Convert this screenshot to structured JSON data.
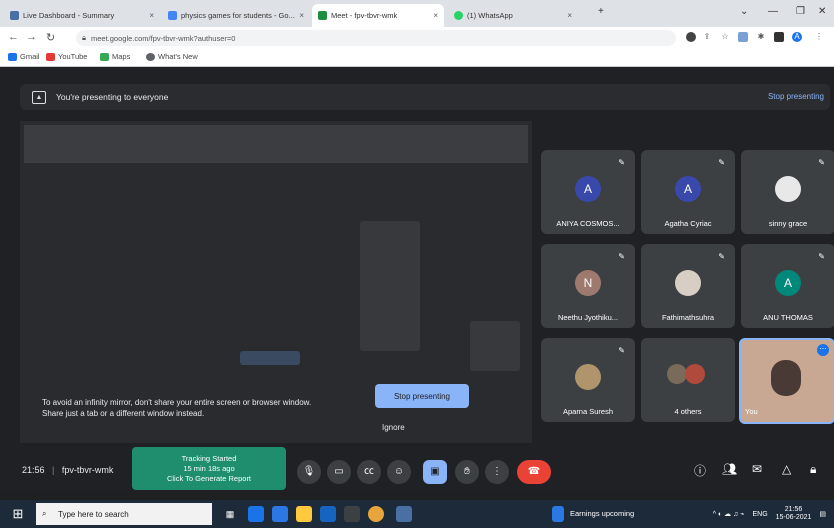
{
  "browser": {
    "tabs": [
      {
        "label": "Live Dashboard - Summary",
        "color": "#4a6fa5"
      },
      {
        "label": "physics games for students - Go...",
        "color": "#4285f4"
      },
      {
        "label": "Meet - fpv-tbvr-wmk",
        "color": "#1e8e3e"
      },
      {
        "label": "(1) WhatsApp",
        "color": "#25d366"
      }
    ],
    "url": "meet.google.com/fpv-tbvr-wmk?authuser=0",
    "bookmarks": [
      "Gmail",
      "YouTube",
      "Maps",
      "What's New"
    ]
  },
  "presenting_bar": {
    "message": "You're presenting to everyone",
    "stop_label": "Stop presenting"
  },
  "preview": {
    "warning_line1": "To avoid an infinity mirror, don't share your entire screen or browser window.",
    "warning_line2": "Share just a tab or a different window instead.",
    "stop_button": "Stop presenting",
    "ignore": "Ignore"
  },
  "participants": [
    {
      "name": "ANIYA COSMOS...",
      "initial": "A",
      "color": "#3949ab"
    },
    {
      "name": "Agatha Cyriac",
      "initial": "A",
      "color": "#3949ab"
    },
    {
      "name": "sinny grace",
      "initial": "",
      "color": "#ffffff"
    },
    {
      "name": "Neethu Jyothiku...",
      "initial": "N",
      "color": "#9e7a6e"
    },
    {
      "name": "Fathimathsuhra",
      "initial": "",
      "color": "#d8cfc4"
    },
    {
      "name": "ANU THOMAS",
      "initial": "A",
      "color": "#00897b"
    },
    {
      "name": "Aparna Suresh",
      "initial": "",
      "color": "#b0956c"
    },
    {
      "name": "4 others",
      "initial": "",
      "color": "#7a6a5a"
    },
    {
      "name": "You",
      "initial": "",
      "color": "#c8a892"
    }
  ],
  "bottom": {
    "time": "21:56",
    "meeting_code": "fpv-tbvr-wmk",
    "tracking_line1": "Tracking Started",
    "tracking_line2": "15 min 18s ago",
    "tracking_line3": "Click To Generate Report"
  },
  "taskbar": {
    "search_placeholder": "Type here to search",
    "weather": "Earnings upcoming",
    "lang": "ENG",
    "time": "21:56",
    "date": "15-06-2021"
  }
}
